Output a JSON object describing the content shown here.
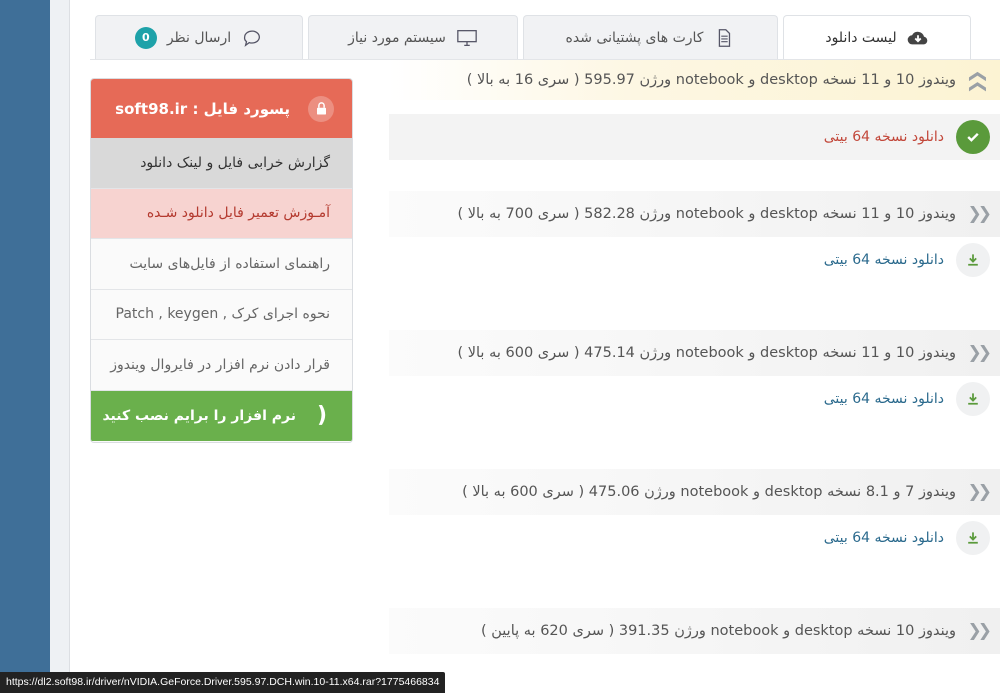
{
  "tabs": [
    {
      "label": "لیست دانلود",
      "icon": "cloud-download-icon",
      "active": true
    },
    {
      "label": "کارت های پشتیانی شده",
      "icon": "document-icon",
      "active": false
    },
    {
      "label": "سیستم مورد نیاز",
      "icon": "monitor-icon",
      "active": false
    },
    {
      "label": "ارسال نظر",
      "icon": "comment-icon",
      "badge": "0",
      "active": false
    }
  ],
  "downloads": [
    {
      "title": "ویندوز 10 و 11 نسخه desktop و notebook ورژن 595.97 ( سری 16 به بالا )",
      "link": "دانلود نسخه 64 بیتی",
      "expanded": true,
      "done": true
    },
    {
      "title": "ویندوز 10 و 11 نسخه desktop و notebook ورژن 582.28 ( سری 700 به بالا )",
      "link": "دانلود نسخه 64 بیتی"
    },
    {
      "title": "ویندوز 10 و 11 نسخه desktop و notebook ورژن 475.14 ( سری 600 به بالا )",
      "link": "دانلود نسخه 64 بیتی"
    },
    {
      "title": "ویندوز 7 و 8.1 نسخه desktop و notebook ورژن 475.06 ( سری 600 به بالا )",
      "link": "دانلود نسخه 64 بیتی"
    },
    {
      "title": "ویندوز 10 نسخه desktop و notebook ورژن 391.35 ( سری 620 به پایین )",
      "link": ""
    }
  ],
  "sidebar": {
    "password_label": "پسورد فایل :",
    "password_value": "soft98.ir",
    "items": [
      {
        "label": "گزارش خرابی فایل و لینک دانلود"
      },
      {
        "label": "آمـوزش تعمیر فایل دانلود شـده"
      },
      {
        "label": "راهنمای استفاده از فایل‌های سایت"
      },
      {
        "label": "نحوه اجرای کرک , Patch , keygen"
      },
      {
        "label": "قرار دادن نرم افزار در فایروال ویندوز"
      }
    ],
    "install_label": "نرم افزار را برایم نصب کنید"
  },
  "status_url": "https://dl2.soft98.ir/driver/nVIDIA.GeForce.Driver.595.97.DCH.win.10-11.x64.rar?1775466834",
  "colors": {
    "accent": "#3f6f98",
    "password": "#e66a57",
    "install": "#6ab04c",
    "badge": "#1ea2a9"
  }
}
